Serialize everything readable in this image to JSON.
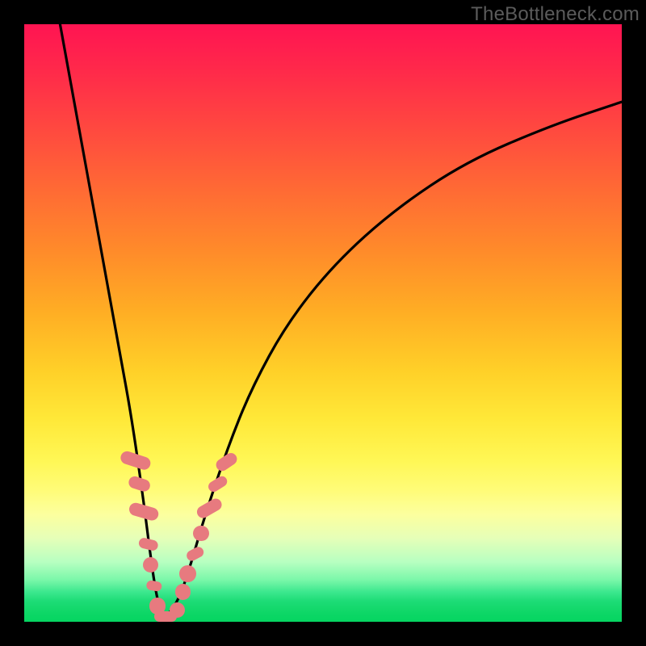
{
  "watermark": "TheBottleneck.com",
  "chart_data": {
    "type": "line",
    "title": "",
    "xlabel": "",
    "ylabel": "",
    "xlim": [
      0,
      100
    ],
    "ylim": [
      0,
      100
    ],
    "grid": false,
    "legend": false,
    "gradient_hint": "vertical red→yellow→green background; curve in black",
    "series": [
      {
        "name": "bottleneck-curve",
        "x": [
          6,
          8,
          10,
          12,
          14,
          16,
          18,
          20,
          21,
          22,
          23,
          24,
          26,
          28,
          30,
          34,
          38,
          44,
          52,
          62,
          74,
          88,
          100
        ],
        "y": [
          100,
          89,
          78,
          67,
          56,
          45,
          34,
          20,
          12,
          5,
          1,
          1,
          4,
          10,
          17,
          29,
          39,
          50,
          60,
          69,
          77,
          83,
          87
        ]
      }
    ],
    "markers": {
      "name": "beads",
      "color": "#e77a7f",
      "points": [
        {
          "x": 18.7,
          "y": 27,
          "shape": "pill",
          "w": 2.2,
          "h": 5.2,
          "angle": -72
        },
        {
          "x": 19.3,
          "y": 23,
          "shape": "pill",
          "w": 2.0,
          "h": 3.6,
          "angle": -72
        },
        {
          "x": 20.0,
          "y": 18.5,
          "shape": "pill",
          "w": 2.2,
          "h": 5.0,
          "angle": -74
        },
        {
          "x": 20.8,
          "y": 13,
          "shape": "pill",
          "w": 1.8,
          "h": 3.2,
          "angle": -76
        },
        {
          "x": 21.2,
          "y": 9.5,
          "shape": "circle",
          "r": 1.3
        },
        {
          "x": 21.7,
          "y": 6,
          "shape": "pill",
          "w": 1.6,
          "h": 2.6,
          "angle": -80
        },
        {
          "x": 22.3,
          "y": 2.6,
          "shape": "circle",
          "r": 1.4
        },
        {
          "x": 23.6,
          "y": 0.9,
          "shape": "pill",
          "w": 3.8,
          "h": 1.8,
          "angle": 0
        },
        {
          "x": 25.6,
          "y": 2.0,
          "shape": "circle",
          "r": 1.3
        },
        {
          "x": 26.6,
          "y": 5.0,
          "shape": "circle",
          "r": 1.3
        },
        {
          "x": 27.4,
          "y": 8.0,
          "shape": "circle",
          "r": 1.4
        },
        {
          "x": 28.6,
          "y": 11.4,
          "shape": "pill",
          "w": 1.8,
          "h": 3.0,
          "angle": 62
        },
        {
          "x": 29.6,
          "y": 14.8,
          "shape": "circle",
          "r": 1.3
        },
        {
          "x": 31.0,
          "y": 19.0,
          "shape": "pill",
          "w": 2.0,
          "h": 4.4,
          "angle": 60
        },
        {
          "x": 32.4,
          "y": 23.0,
          "shape": "pill",
          "w": 1.8,
          "h": 3.4,
          "angle": 58
        },
        {
          "x": 33.8,
          "y": 26.8,
          "shape": "pill",
          "w": 2.0,
          "h": 3.8,
          "angle": 56
        }
      ]
    }
  }
}
